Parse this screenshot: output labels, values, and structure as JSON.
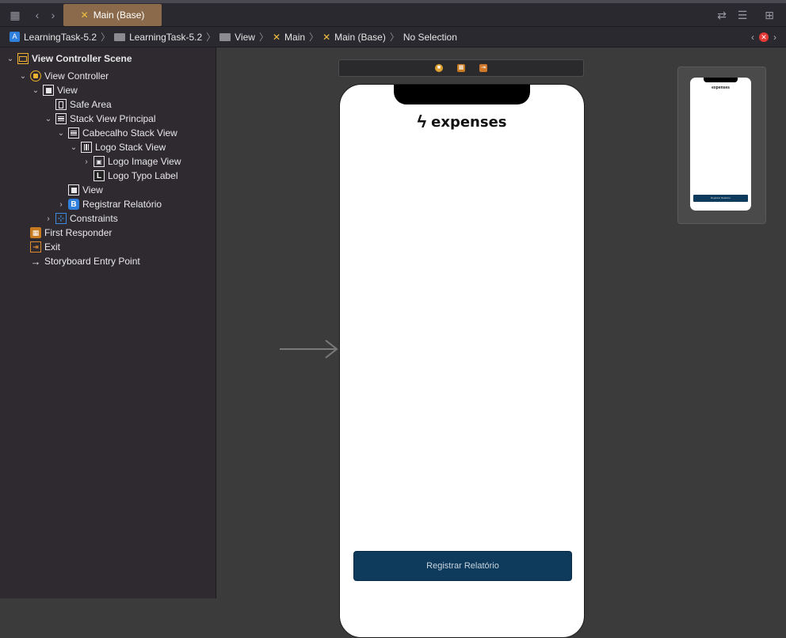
{
  "tabbar": {
    "active_tab": "Main (Base)"
  },
  "breadcrumb": {
    "items": [
      "LearningTask-5.2",
      "LearningTask-5.2",
      "View",
      "Main",
      "Main (Base)",
      "No Selection"
    ]
  },
  "outline": {
    "scene": "View Controller Scene",
    "view_controller": "View Controller",
    "view": "View",
    "safe_area": "Safe Area",
    "stack_view_principal": "Stack View Principal",
    "cabecalho_stack_view": "Cabecalho Stack View",
    "logo_stack_view": "Logo Stack View",
    "logo_image_view": "Logo Image View",
    "logo_typo_label": "Logo Typo Label",
    "inner_view": "View",
    "registrar_button": "Registrar Relatório",
    "constraints": "Constraints",
    "first_responder": "First Responder",
    "exit": "Exit",
    "entry_point": "Storyboard Entry Point",
    "icon_labels": {
      "button": "B",
      "label": "L"
    }
  },
  "canvas": {
    "logo_text": "expenses",
    "button_label": "Registrar Relatório",
    "mini_logo": "expenses",
    "mini_button": "Registrar Relatório"
  },
  "colors": {
    "button_bg": "#0e3a5c",
    "accent_yellow": "#f0c040",
    "active_tab_bg": "#8a6a4a",
    "error_badge": "#e53935"
  }
}
